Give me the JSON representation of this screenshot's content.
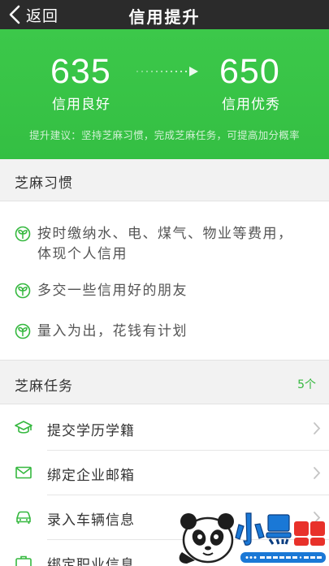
{
  "navbar": {
    "back_label": "返回",
    "title": "信用提升"
  },
  "hero": {
    "current_score": "635",
    "current_label": "信用良好",
    "target_score": "650",
    "target_label": "信用优秀",
    "advice": "提升建议：坚持芝麻习惯，完成芝麻任务，可提高加分概率"
  },
  "habits_section": {
    "title": "芝麻习惯",
    "items": [
      {
        "text": "按时缴纳水、电、煤气、物业等费用，体现个人信用",
        "icon": "sprout-icon"
      },
      {
        "text": "多交一些信用好的朋友",
        "icon": "sprout-icon"
      },
      {
        "text": "量入为出，花钱有计划",
        "icon": "sprout-icon"
      }
    ]
  },
  "tasks_section": {
    "title": "芝麻任务",
    "count": "5个",
    "items": [
      {
        "label": "提交学历学籍",
        "icon": "graduation-cap-icon"
      },
      {
        "label": "绑定企业邮箱",
        "icon": "envelope-icon"
      },
      {
        "label": "录入车辆信息",
        "icon": "car-icon"
      },
      {
        "label": "绑定职业信息",
        "icon": "briefcase-icon"
      }
    ]
  },
  "watermark": {
    "brand": "小黑游戏",
    "site": "www.xiaohei.com"
  },
  "colors": {
    "accent": "#35b83f",
    "navbar": "#2b2b2b"
  }
}
